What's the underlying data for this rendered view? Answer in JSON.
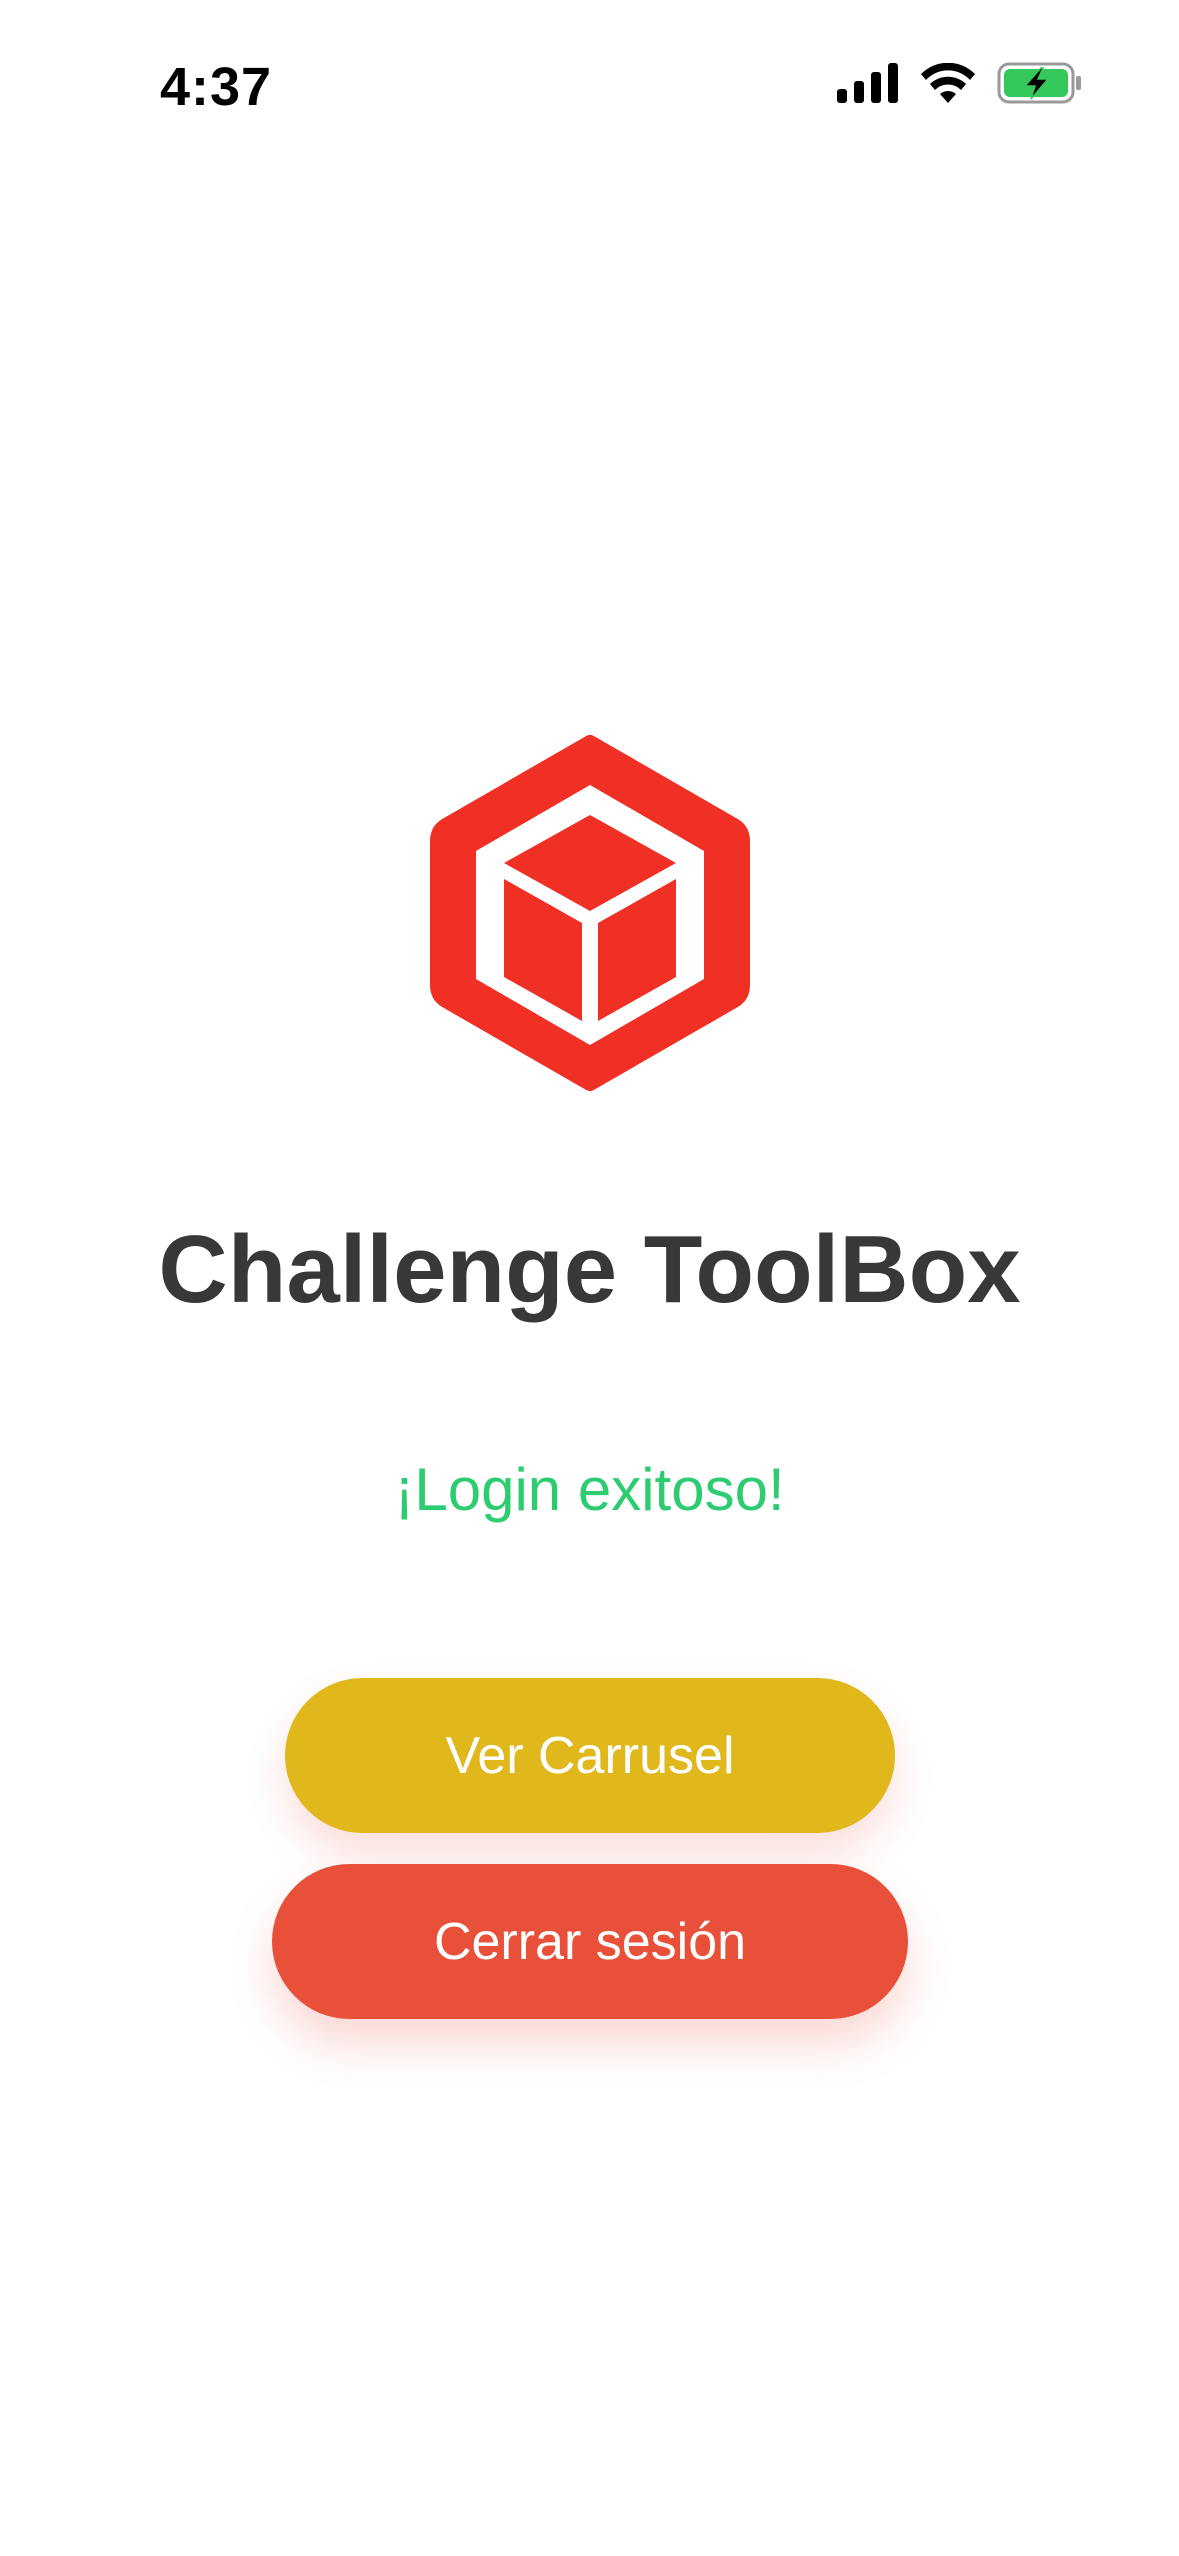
{
  "status_bar": {
    "time": "4:37",
    "icons": [
      "signal-icon",
      "wifi-icon",
      "battery-charging-icon"
    ],
    "battery_color": "#34c759"
  },
  "logo": {
    "icon": "cube-logo-icon",
    "color": "#f03024"
  },
  "title": "Challenge ToolBox",
  "message": "¡Login exitoso!",
  "buttons": {
    "carousel_label": "Ver Carrusel",
    "logout_label": "Cerrar sesión"
  },
  "colors": {
    "title": "#383838",
    "success": "#2ecc71",
    "carousel_button": "#e0b81c",
    "logout_button": "#e8503a"
  }
}
